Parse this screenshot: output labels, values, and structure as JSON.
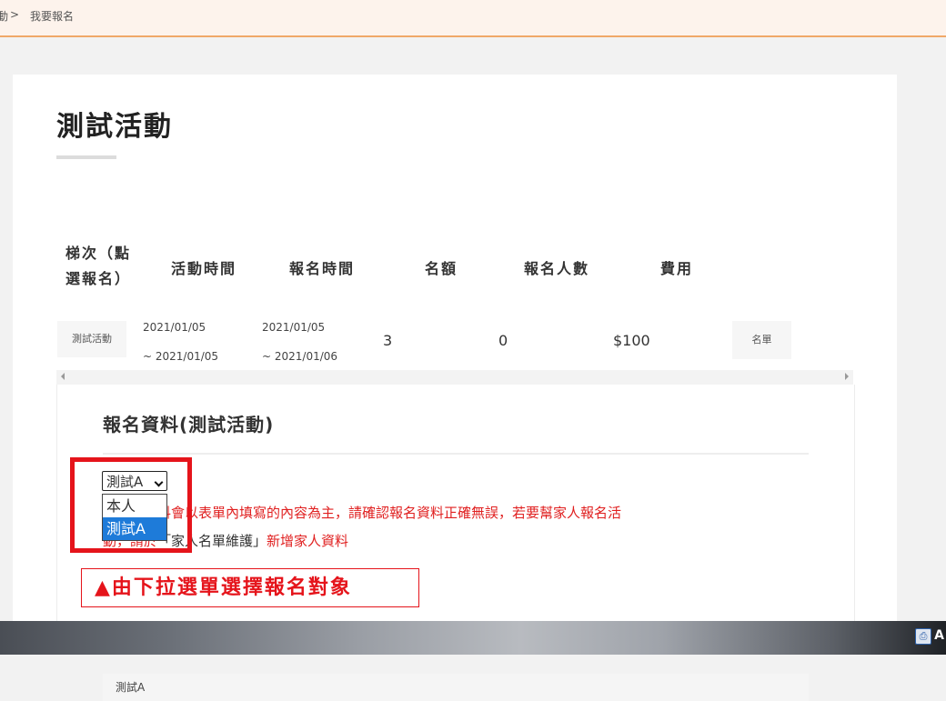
{
  "breadcrumb": {
    "parent": "動",
    "separator": ">",
    "current": "我要報名"
  },
  "event": {
    "title": "測試活動"
  },
  "table": {
    "headers": [
      "梯次（點選報名）",
      "活動時間",
      "報名時間",
      "名額",
      "報名人數",
      "費用"
    ],
    "row": {
      "session": "測試活動",
      "activity_start": "2021/01/05",
      "activity_end": "~ 2021/01/05",
      "signup_start": "2021/01/05",
      "signup_end": "~ 2021/01/06",
      "quota": "3",
      "enrolled": "0",
      "fee": "$100",
      "list_button": "名單"
    }
  },
  "form": {
    "title": "報名資料(測試活動)",
    "select": {
      "value": "測試A",
      "options": [
        "本人",
        "測試A"
      ],
      "selected_index": 1
    },
    "notice_line1": "終報名資料會以表單內填寫的內容為主，請確認報名資料正確無誤，若要幫家人報名活",
    "notice_line2_prefix": "動，請於",
    "notice_line2_link": "「家人名單維護」",
    "notice_line2_suffix": "新增家人資料",
    "subsection_label": "測試A"
  },
  "annotation": {
    "caption": "▲由下拉選單選擇報名對象"
  },
  "taskbar": {
    "text": "A"
  },
  "colors": {
    "accent_orange": "#f0a868",
    "highlight_red": "#e5141b",
    "select_blue": "#1e7bd9"
  }
}
